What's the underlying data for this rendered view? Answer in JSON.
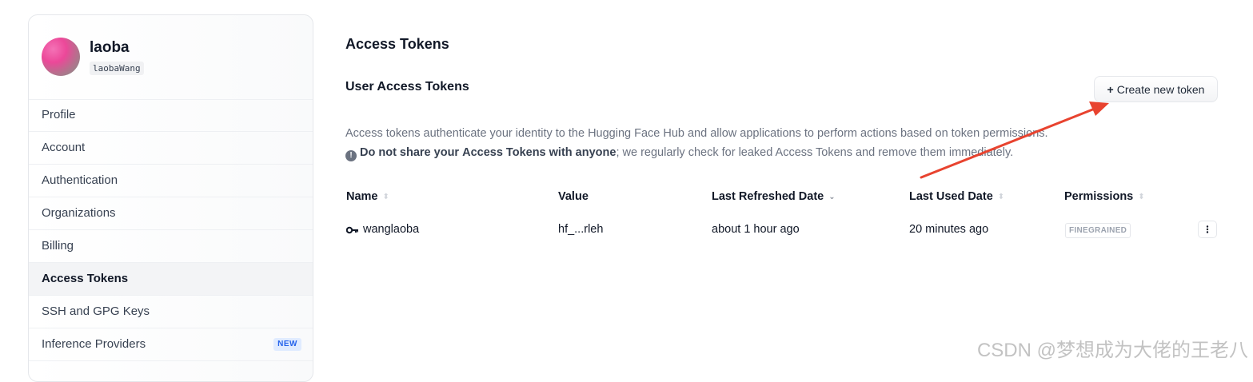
{
  "sidebar": {
    "user": {
      "name": "laoba",
      "handle": "laobaWang"
    },
    "items": [
      {
        "label": "Profile",
        "active": false
      },
      {
        "label": "Account",
        "active": false
      },
      {
        "label": "Authentication",
        "active": false
      },
      {
        "label": "Organizations",
        "active": false
      },
      {
        "label": "Billing",
        "active": false
      },
      {
        "label": "Access Tokens",
        "active": true
      },
      {
        "label": "SSH and GPG Keys",
        "active": false
      },
      {
        "label": "Inference Providers",
        "active": false,
        "badge": "NEW"
      }
    ]
  },
  "main": {
    "title": "Access Tokens",
    "section_title": "User Access Tokens",
    "create_button": {
      "icon": "plus",
      "label": "Create new token"
    },
    "description": "Access tokens authenticate your identity to the Hugging Face Hub and allow applications to perform actions based on token permissions.",
    "warning": {
      "icon": "exclamation-circle-icon",
      "part1": "Do not share your",
      "part2": "Access Tokens",
      "part3": "with anyone",
      "part4": "; we regularly check for leaked Access Tokens and remove them immediately."
    }
  },
  "table": {
    "columns": [
      {
        "label": "Name",
        "sortable": true
      },
      {
        "label": "Value",
        "sortable": false
      },
      {
        "label": "Last Refreshed Date",
        "sortable": true,
        "sorted": "desc"
      },
      {
        "label": "Last Used Date",
        "sortable": true
      },
      {
        "label": "Permissions",
        "sortable": true
      }
    ],
    "rows": [
      {
        "name": "wanglaoba",
        "value": "hf_...rleh",
        "last_refreshed": "about 1 hour ago",
        "last_used": "20 minutes ago",
        "permissions": "FINEGRAINED"
      }
    ]
  },
  "annotation": {
    "color": "#e8432f"
  },
  "watermark": "CSDN @梦想成为大佬的王老八",
  "colors": {
    "accent_blue": "#2563eb",
    "text_primary": "#111827",
    "text_muted": "#6b7280"
  }
}
